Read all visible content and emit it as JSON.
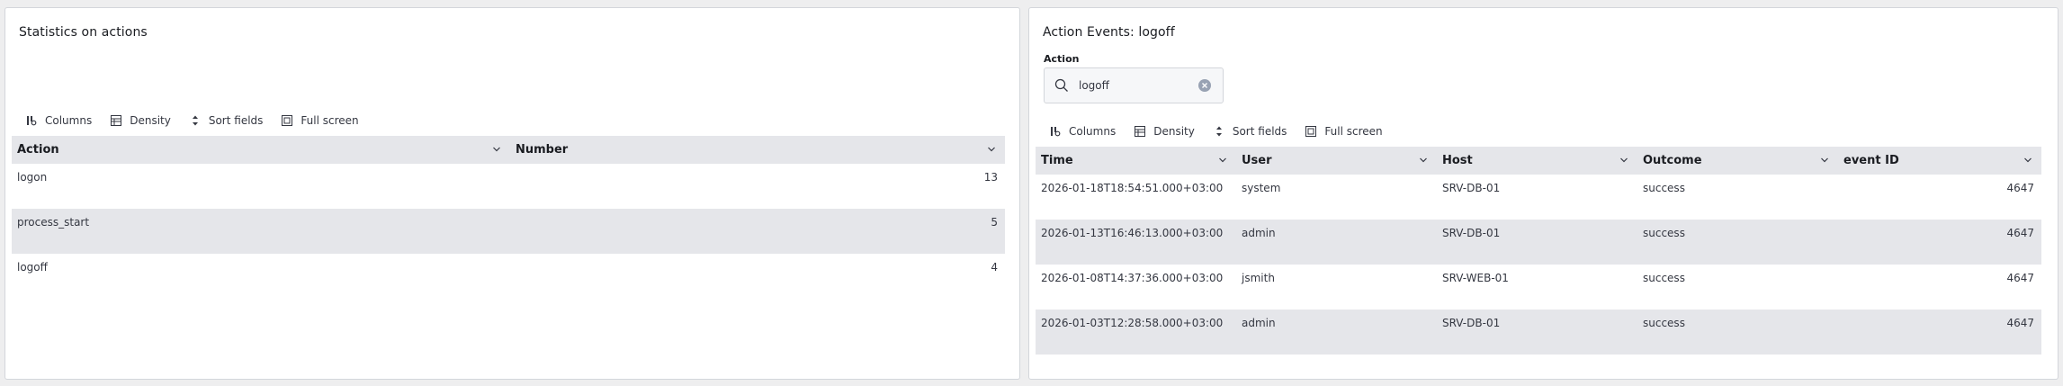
{
  "left_panel": {
    "title": "Statistics on actions",
    "toolbar": {
      "columns": "Columns",
      "density": "Density",
      "sort_fields": "Sort fields",
      "full_screen": "Full screen"
    },
    "table": {
      "headers": [
        "Action",
        "Number"
      ],
      "rows": [
        [
          "logon",
          "13"
        ],
        [
          "process_start",
          "5"
        ],
        [
          "logoff",
          "4"
        ]
      ]
    }
  },
  "right_panel": {
    "title": "Action Events: logoff",
    "filter_label": "Action",
    "search_value": "logoff",
    "toolbar": {
      "columns": "Columns",
      "density": "Density",
      "sort_fields": "Sort fields",
      "full_screen": "Full screen"
    },
    "table": {
      "headers": [
        "Time",
        "User",
        "Host",
        "Outcome",
        "event ID"
      ],
      "rows": [
        [
          "2026-01-18T18:54:51.000+03:00",
          "system",
          "SRV-DB-01",
          "success",
          "4647"
        ],
        [
          "2026-01-13T16:46:13.000+03:00",
          "admin",
          "SRV-DB-01",
          "success",
          "4647"
        ],
        [
          "2026-01-08T14:37:36.000+03:00",
          "jsmith",
          "SRV-WEB-01",
          "success",
          "4647"
        ],
        [
          "2026-01-03T12:28:58.000+03:00",
          "admin",
          "SRV-DB-01",
          "success",
          "4647"
        ]
      ]
    }
  }
}
